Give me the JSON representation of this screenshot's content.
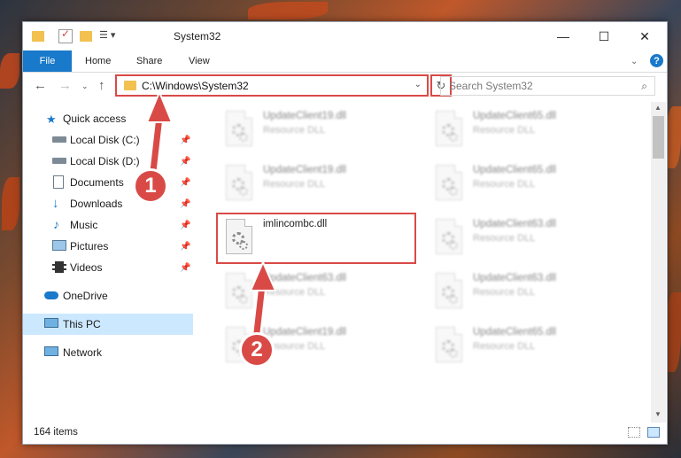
{
  "window": {
    "title": "System32",
    "controls": {
      "minimize": "—",
      "maximize": "☐",
      "close": "✕"
    }
  },
  "ribbon": {
    "tabs": [
      "File",
      "Home",
      "Share",
      "View"
    ],
    "expand_icon": "chevron-down-icon",
    "help_icon": "help-icon"
  },
  "address_bar": {
    "path": "C:\\Windows\\System32",
    "search_placeholder": "Search System32"
  },
  "nav_pane": {
    "items": [
      {
        "label": "Quick access",
        "icon": "star-icon"
      },
      {
        "label": "Local Disk (C:)",
        "icon": "drive-icon",
        "pinned": true
      },
      {
        "label": "Local Disk (D:)",
        "icon": "drive-icon",
        "pinned": true
      },
      {
        "label": "Documents",
        "icon": "documents-icon",
        "pinned": true
      },
      {
        "label": "Downloads",
        "icon": "download-icon",
        "pinned": true
      },
      {
        "label": "Music",
        "icon": "music-icon",
        "pinned": true
      },
      {
        "label": "Pictures",
        "icon": "pictures-icon",
        "pinned": true
      },
      {
        "label": "Videos",
        "icon": "videos-icon",
        "pinned": true
      },
      {
        "label": "OneDrive",
        "icon": "cloud-icon"
      },
      {
        "label": "This PC",
        "icon": "computer-icon",
        "selected": true
      },
      {
        "label": "Network",
        "icon": "network-icon"
      }
    ]
  },
  "files": {
    "left": [
      {
        "name": "UpdateClient19.dll",
        "type": "Resource DLL",
        "blurred": true
      },
      {
        "name": "UpdateClient19.dll",
        "type": "Resource DLL",
        "blurred": true
      },
      {
        "name": "imlincombc.dll",
        "type": "",
        "blurred": false
      },
      {
        "name": "UpdateClient63.dll",
        "type": "Resource DLL",
        "blurred": true
      },
      {
        "name": "UpdateClient19.dll",
        "type": "Resource DLL",
        "blurred": true
      }
    ],
    "right": [
      {
        "name": "UpdateClient65.dll",
        "type": "Resource DLL",
        "blurred": true
      },
      {
        "name": "UpdateClient65.dll",
        "type": "Resource DLL",
        "blurred": true
      },
      {
        "name": "UpdateClient63.dll",
        "type": "Resource DLL",
        "blurred": true
      },
      {
        "name": "UpdateClient63.dll",
        "type": "Resource DLL",
        "blurred": true
      },
      {
        "name": "UpdateClient65.dll",
        "type": "Resource DLL",
        "blurred": true
      }
    ]
  },
  "status_bar": {
    "item_count": "164 items"
  },
  "annotations": {
    "step1": "1",
    "step2": "2",
    "color": "#d94a47"
  },
  "colors": {
    "file_tab": "#1979ca",
    "selection": "#cce8ff",
    "highlight": "#d94a47"
  }
}
